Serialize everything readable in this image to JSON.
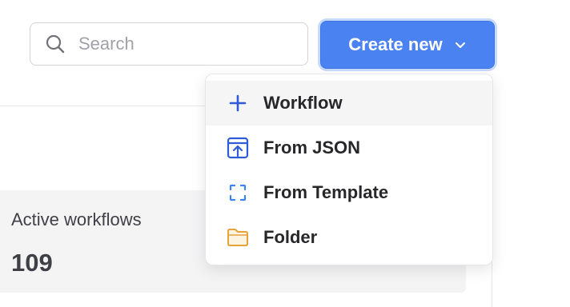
{
  "search": {
    "placeholder": "Search",
    "value": ""
  },
  "create_button": {
    "label": "Create new"
  },
  "dropdown": {
    "items": [
      {
        "label": "Workflow",
        "icon": "plus-icon",
        "color": "#2f5bd6"
      },
      {
        "label": "From JSON",
        "icon": "import-json-icon",
        "color": "#2f5bd6"
      },
      {
        "label": "From Template",
        "icon": "template-icon",
        "color": "#3b82f6"
      },
      {
        "label": "Folder",
        "icon": "folder-icon",
        "color": "#e7a23a"
      }
    ]
  },
  "stats": {
    "active_workflows_label": "Active workflows",
    "active_workflows_value": "109"
  },
  "colors": {
    "accent": "#4a83f1",
    "accent_ring": "#c7d9fc"
  }
}
